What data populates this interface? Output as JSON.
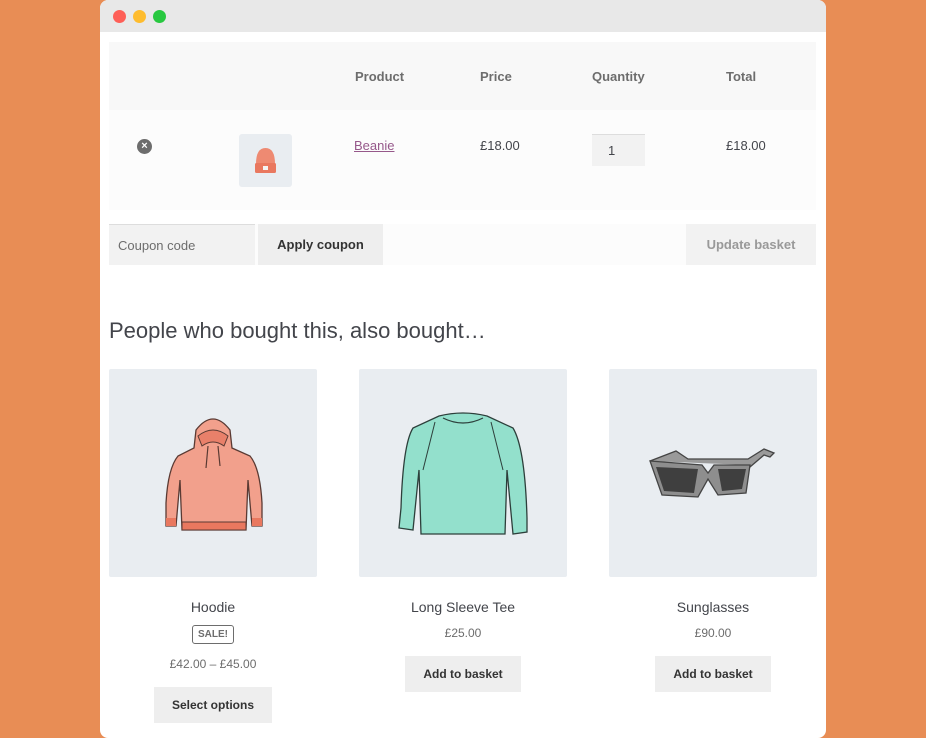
{
  "window": {
    "controls": [
      "close",
      "minimize",
      "maximize"
    ]
  },
  "cart": {
    "headers": {
      "product": "Product",
      "price": "Price",
      "quantity": "Quantity",
      "total": "Total"
    },
    "items": [
      {
        "name": "Beanie",
        "price": "£18.00",
        "quantity": "1",
        "total": "£18.00",
        "remove_icon": "remove-circle-x-icon",
        "thumbnail": "beanie-image"
      }
    ],
    "coupon": {
      "placeholder": "Coupon code",
      "value": ""
    },
    "apply_coupon_label": "Apply coupon",
    "update_basket_label": "Update basket"
  },
  "cross_sells": {
    "title": "People who bought this, also bought…",
    "products": [
      {
        "name": "Hoodie",
        "badge": "SALE!",
        "price": "£42.00 – £45.00",
        "button": "Select options",
        "image": "hoodie-image"
      },
      {
        "name": "Long Sleeve Tee",
        "price": "£25.00",
        "button": "Add to basket",
        "image": "long-sleeve-tee-image"
      },
      {
        "name": "Sunglasses",
        "price": "£90.00",
        "button": "Add to basket",
        "image": "sunglasses-image"
      }
    ]
  },
  "colors": {
    "background": "#e88d55",
    "link": "#96588a",
    "text": "#43454b",
    "button_bg": "#eeeeee"
  }
}
